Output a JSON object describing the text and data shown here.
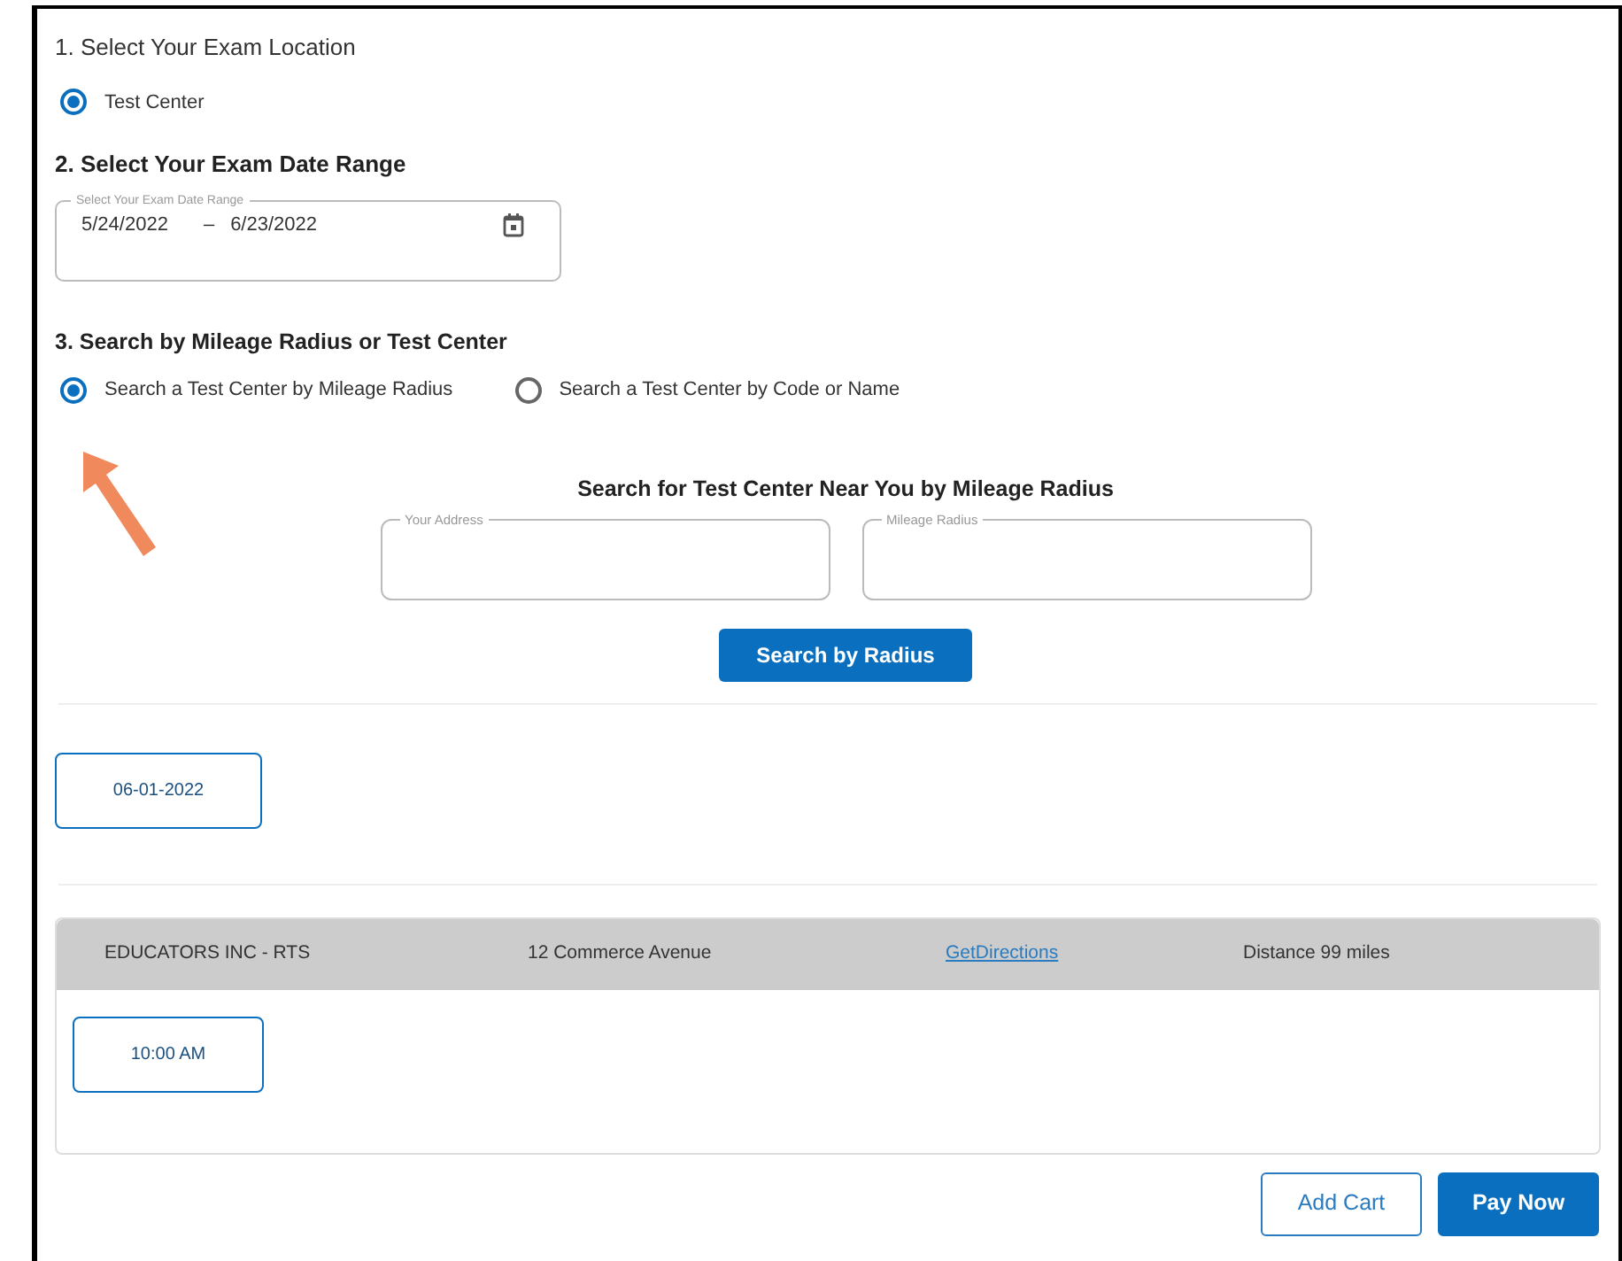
{
  "location": {
    "heading": "1. Select Your Exam Location",
    "options": [
      {
        "label": "Test Center",
        "selected": true
      }
    ]
  },
  "date_range": {
    "heading": "2. Select Your Exam Date Range",
    "label": "Select Your Exam Date Range",
    "start": "5/24/2022",
    "separator": "–",
    "end": "6/23/2022"
  },
  "search_mode": {
    "heading": "3. Search by Mileage Radius or Test Center",
    "options": [
      {
        "label": "Search a Test Center by Mileage Radius",
        "selected": true
      },
      {
        "label": "Search a Test Center by Code or Name",
        "selected": false
      }
    ]
  },
  "radius_search": {
    "heading": "Search for Test Center Near You by Mileage Radius",
    "fields": [
      {
        "label": "Your Address"
      },
      {
        "label": "Mileage Radius"
      }
    ],
    "button": "Search by Radius"
  },
  "dates": [
    "06-01-2022"
  ],
  "center": {
    "name": "EDUCATORS INC - RTS",
    "address": "12 Commerce Avenue",
    "link": "GetDirections",
    "distance": "Distance 99 miles",
    "times": [
      "10:00 AM"
    ]
  },
  "actions": [
    {
      "label": "Add Cart",
      "kind": "outline"
    },
    {
      "label": "Pay Now",
      "kind": "primary"
    }
  ]
}
